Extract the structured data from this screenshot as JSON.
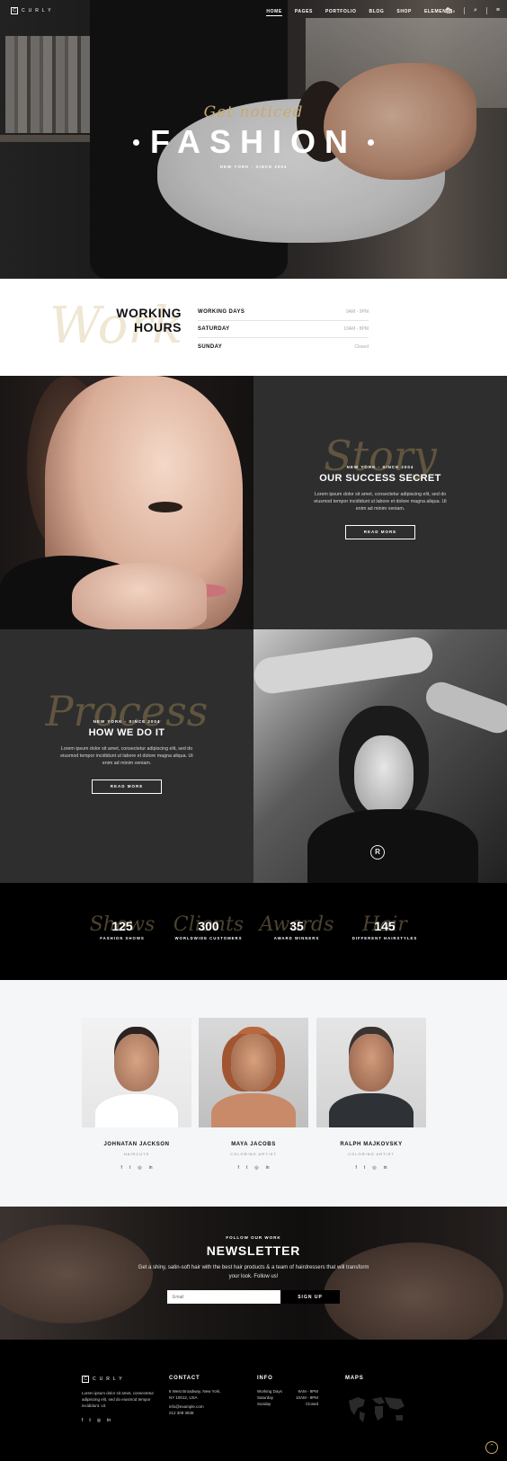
{
  "nav": {
    "logo": "CURLY",
    "logo_letter": "C",
    "items": [
      "HOME",
      "PAGES",
      "PORTFOLIO",
      "BLOG",
      "SHOP",
      "ELEMENTS"
    ],
    "cart_count": "0"
  },
  "hero": {
    "script": "Get noticed",
    "title": "FASHION",
    "subtitle": "NEW YORK - SINCE 2004"
  },
  "hours": {
    "ghost": "Work",
    "title_line1": "WORKING",
    "title_line2": "HOURS",
    "rows": [
      {
        "day": "WORKING DAYS",
        "time": "9AM - 9PM"
      },
      {
        "day": "SATURDAY",
        "time": "10AM - 8PM"
      },
      {
        "day": "SUNDAY",
        "time": "Closed"
      }
    ]
  },
  "success": {
    "script": "Story",
    "kicker": "NEW YORK - SINCE 2004",
    "heading": "OUR SUCCESS SECRET",
    "text": "Lorem ipsum dolor sit amet, consectetur adipiscing elit, sed do eiusmod tempor incididunt ut labore et dolore magna aliqua. Ut enim ad minim veniam.",
    "button": "READ MORE"
  },
  "process": {
    "script": "Process",
    "kicker": "NEW YORK - SINCE 2004",
    "heading": "HOW WE DO IT",
    "text": "Lorem ipsum dolor sit amet, consectetur adipiscing elit, sed do eiusmod tempor incididunt ut labore et dolore magna aliqua. Ut enim ad minim veniam.",
    "button": "READ MORE"
  },
  "stats": [
    {
      "num": "125",
      "label": "FASHION SHOWS",
      "script": "Shows"
    },
    {
      "num": "300",
      "label": "WORLDWIDE CUSTOMERS",
      "script": "Clients"
    },
    {
      "num": "35",
      "label": "AWARD WINNERS",
      "script": "Awards"
    },
    {
      "num": "145",
      "label": "DIFFERENT HAIRSTYLES",
      "script": "Hair"
    }
  ],
  "team": [
    {
      "name": "JOHNATAN JACKSON",
      "role": "HAIRCUTS"
    },
    {
      "name": "MAYA JACOBS",
      "role": "COLORING ARTIST"
    },
    {
      "name": "RALPH MAJKOVSKY",
      "role": "COLORING ARTIST"
    }
  ],
  "social_icons": [
    "f",
    "t",
    "◎",
    "in"
  ],
  "newsletter": {
    "kicker": "FOLLOW OUR WORK",
    "heading": "NEWSLETTER",
    "text": "Get a shiny, satin-soft hair with the best hair products & a team of hairdressers that will transform your look. Follow us!",
    "email_placeholder": "Email",
    "button": "SIGN UP"
  },
  "footer": {
    "logo": "CURLY",
    "logo_letter": "C",
    "about": "Lorem ipsum dolor sit amet, consectetur adipiscing elit, sed do eiusmod tempor incididunt. Ut.",
    "contact_title": "CONTACT",
    "contact_lines": [
      "6 West Broadway, New York,",
      "NY 10012, USA",
      "info@example.com",
      "212 308 3838"
    ],
    "info_title": "INFO",
    "info_rows": [
      {
        "day": "Working Days",
        "time": "9AM - 9PM"
      },
      {
        "day": "Saturday",
        "time": "10AM - 8PM"
      },
      {
        "day": "Sunday",
        "time": "Closed"
      }
    ],
    "maps_title": "MAPS"
  },
  "colors": {
    "accent": "#c8a96e",
    "dark_panel": "#2e2e2e"
  }
}
